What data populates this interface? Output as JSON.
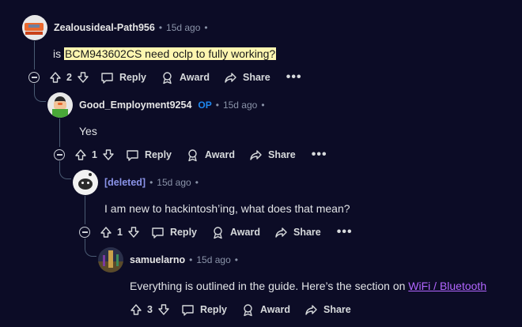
{
  "comments": [
    {
      "author": "Zealousideal-Path956",
      "time": "15d ago",
      "body_prefix": "is",
      "body_highlight": "BCM943602CS need oclp to fully working?",
      "votes": "2",
      "avatar": "orange-robot-avatar"
    },
    {
      "author": "Good_Employment9254",
      "op_badge": "OP",
      "time": "15d ago",
      "body": "Yes",
      "votes": "1",
      "avatar": "green-character-avatar"
    },
    {
      "author": "[deleted]",
      "time": "15d ago",
      "body": "I am new to hackintosh’ing, what does that mean?",
      "votes": "1",
      "avatar": "deleted-user-avatar"
    },
    {
      "author": "samuelarno",
      "time": "15d ago",
      "body_prefix": "Everything is outlined in the guide. Here’s the section on ",
      "body_link": "WiFi / Bluetooth",
      "votes": "3",
      "avatar": "photo-avatar"
    }
  ],
  "actions": {
    "reply": "Reply",
    "award": "Award",
    "share": "Share",
    "more": "•••"
  },
  "meta": {
    "separator": "•"
  },
  "colors": {
    "background": "#0c0c26",
    "highlight": "#fdf6b0",
    "op_badge": "#1e88f0",
    "link": "#b266ff",
    "deleted": "#8a93e8"
  }
}
